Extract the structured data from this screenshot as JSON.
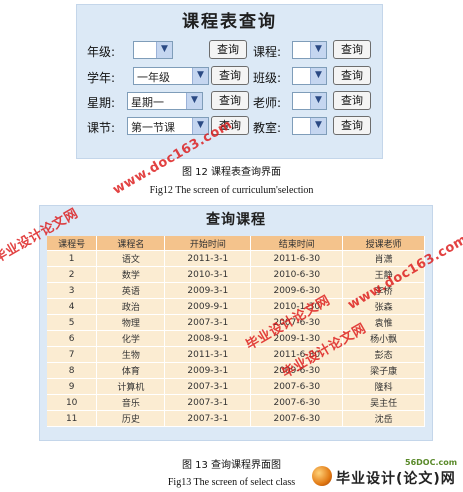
{
  "form": {
    "title": "课程表查询",
    "query_label": "查询",
    "rows": [
      {
        "left_label": "年级:",
        "left_value": "",
        "right_label": "课程:",
        "right_value": ""
      },
      {
        "left_label": "学年:",
        "left_value": "一年级",
        "right_label": "班级:",
        "right_value": ""
      },
      {
        "left_label": "星期:",
        "left_value": "星期一",
        "right_label": "老师:",
        "right_value": ""
      },
      {
        "left_label": "课节:",
        "left_value": "第一节课",
        "right_label": "教室:",
        "right_value": ""
      }
    ]
  },
  "fig12": {
    "caption_cn": "图 12 课程表查询界面",
    "caption_en": "Fig12 The screen of curriculum'selection"
  },
  "results": {
    "title": "查询课程",
    "columns": [
      "课程号",
      "课程名",
      "开始时间",
      "结束时间",
      "授课老师"
    ],
    "rows": [
      [
        "1",
        "语文",
        "2011-3-1",
        "2011-6-30",
        "肖潇"
      ],
      [
        "2",
        "数学",
        "2010-3-1",
        "2010-6-30",
        "王静"
      ],
      [
        "3",
        "英语",
        "2009-3-1",
        "2009-6-30",
        "李桥"
      ],
      [
        "4",
        "政治",
        "2009-9-1",
        "2010-1-30",
        "张森"
      ],
      [
        "5",
        "物理",
        "2007-3-1",
        "2007-6-30",
        "袁惟"
      ],
      [
        "6",
        "化学",
        "2008-9-1",
        "2009-1-30",
        "杨小飘"
      ],
      [
        "7",
        "生物",
        "2011-3-1",
        "2011-6-30",
        "彭态"
      ],
      [
        "8",
        "体育",
        "2009-3-1",
        "2009-6-30",
        "梁子康"
      ],
      [
        "9",
        "计算机",
        "2007-3-1",
        "2007-6-30",
        "隆科"
      ],
      [
        "10",
        "音乐",
        "2007-3-1",
        "2007-6-30",
        "吴主任"
      ],
      [
        "11",
        "历史",
        "2007-3-1",
        "2007-6-30",
        "沈岳"
      ]
    ]
  },
  "fig13": {
    "caption_cn": "图 13 查询课程界面图",
    "caption_en": "Fig13 The screen of select class"
  },
  "watermarks": {
    "url_text": "www.doc163.com",
    "site_text": "毕业设计论文网",
    "logo_site": "56DOC.com",
    "logo_brand": "毕业设计(论文)网"
  },
  "colors": {
    "panel_bg": "#dce9f6",
    "header_bg": "#f4c38c",
    "row_bg": "#fbecd2",
    "watermark": "#dc1919"
  }
}
